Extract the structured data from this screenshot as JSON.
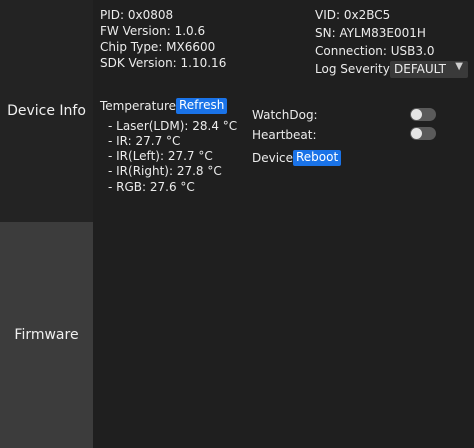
{
  "sidebar": {
    "device_info": "Device Info",
    "firmware": "Firmware"
  },
  "info": {
    "pid": "PID: 0x0808",
    "fw": "FW Version: 1.0.6",
    "chip": "Chip Type: MX6600",
    "sdk": "SDK Version: 1.10.16",
    "vid": "VID: 0x2BC5",
    "sn": "SN:  AYLM83E001H",
    "connection": "Connection: USB3.0",
    "log_label": "Log Severity:",
    "log_value": "DEFAULT"
  },
  "temperature": {
    "label": "Temperature:",
    "refresh": "Refresh",
    "items": [
      "- Laser(LDM): 28.4 °C",
      "- IR: 27.7 °C",
      "- IR(Left): 27.7 °C",
      "- IR(Right): 27.8 °C",
      "- RGB: 27.6 °C"
    ]
  },
  "controls": {
    "watchdog": "WatchDog:",
    "heartbeat": "Heartbeat:",
    "device": "Device:",
    "reboot": "Reboot",
    "watchdog_on": false,
    "heartbeat_on": false
  },
  "colors": {
    "accent": "#1a73e8",
    "background": "#1f1f1f",
    "sidebar_active": "#232323",
    "sidebar_inactive": "#3c3c3c"
  },
  "icons": {
    "select_arrow": "chevron-down-icon"
  }
}
